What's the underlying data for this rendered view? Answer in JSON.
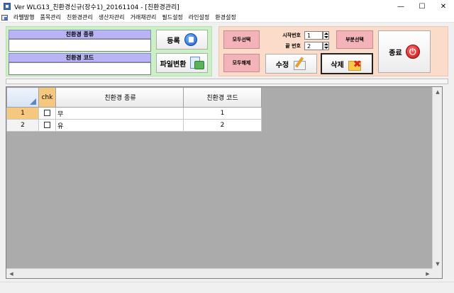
{
  "window": {
    "title": "Ver WLG13_친환경신규(장수1)_20161104 - [친환경관리]",
    "minimize": "—",
    "maximize": "☐",
    "close": "✕"
  },
  "menu": {
    "items": [
      "라벨발행",
      "품목관리",
      "친환경관리",
      "생산자관리",
      "거래채관리",
      "필드설정",
      "라인설정",
      "환경설정"
    ]
  },
  "form": {
    "kind_label": "친환경 종류",
    "kind_value": "",
    "code_label": "친환경 코드",
    "code_value": ""
  },
  "buttons": {
    "register": "등록",
    "file_convert": "파일변환",
    "select_all": "모두선택",
    "deselect_all": "모두해제",
    "edit": "수정",
    "delete": "삭제",
    "partial_select": "부분선택",
    "exit": "종료"
  },
  "range": {
    "start_label": "시작번호",
    "start_value": "1",
    "end_label": "끝 번호",
    "end_value": "2"
  },
  "grid": {
    "columns": [
      "chk",
      "친환경 종류",
      "친환경 코드"
    ],
    "rows": [
      {
        "num": "1",
        "checked": false,
        "kind": "무",
        "code": "1"
      },
      {
        "num": "2",
        "checked": false,
        "kind": "유",
        "code": "2"
      }
    ]
  },
  "colors": {
    "green_panel": "#c9f1c3",
    "peach_panel": "#fbdccb",
    "label_purple": "#b9b4f4",
    "pink_button": "#f3b3b8",
    "active_orange": "#f6c77e"
  }
}
